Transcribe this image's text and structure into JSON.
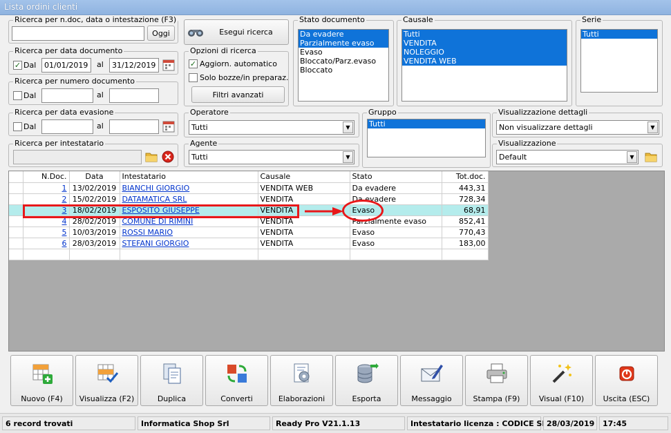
{
  "window": {
    "title": "Lista ordini clienti"
  },
  "search_doc": {
    "label": "Ricerca per n.doc, data o intestazione (F3)",
    "value": "",
    "button": "Oggi"
  },
  "execute_search": {
    "label": "Esegui ricerca"
  },
  "by_date": {
    "label": "Ricerca per data documento",
    "from_label": "Dal",
    "from_checked": true,
    "from_value": "01/01/2019",
    "to_label": "al",
    "to_value": "31/12/2019"
  },
  "search_options": {
    "label": "Opzioni di ricerca",
    "auto_update": "Aggiorn. automatico",
    "auto_update_checked": true,
    "drafts": "Solo bozze/in preparaz.",
    "drafts_checked": false,
    "advanced": "Filtri avanzati"
  },
  "by_number": {
    "label": "Ricerca per numero documento",
    "from_label": "Dal",
    "from_checked": false,
    "from_value": "",
    "to_label": "al",
    "to_value": ""
  },
  "doc_state": {
    "label": "Stato documento",
    "items": [
      {
        "text": "Da evadere",
        "selected": true
      },
      {
        "text": "Parzialmente evaso",
        "selected": true
      },
      {
        "text": "Evaso",
        "selected": false
      },
      {
        "text": "Bloccato/Parz.evaso",
        "selected": false
      },
      {
        "text": "Bloccato",
        "selected": false
      }
    ]
  },
  "causale": {
    "label": "Causale",
    "items": [
      {
        "text": "Tutti",
        "selected": true
      },
      {
        "text": "VENDITA",
        "selected": true
      },
      {
        "text": "NOLEGGIO",
        "selected": true
      },
      {
        "text": "VENDITA WEB",
        "selected": true
      }
    ]
  },
  "serie": {
    "label": "Serie",
    "items": [
      {
        "text": "Tutti",
        "selected": true
      }
    ]
  },
  "by_evasion": {
    "label": "Ricerca per data evasione",
    "from_label": "Dal",
    "from_checked": false,
    "from_value": "",
    "to_label": "al",
    "to_value": ""
  },
  "operator": {
    "label": "Operatore",
    "value": "Tutti"
  },
  "gruppo": {
    "label": "Gruppo",
    "items": [
      {
        "text": "Tutti",
        "selected": true
      }
    ]
  },
  "details_view": {
    "label": "Visualizzazione dettagli",
    "value": "Non visualizzare dettagli"
  },
  "by_holder": {
    "label": "Ricerca per intestatario",
    "value": ""
  },
  "agent": {
    "label": "Agente",
    "value": "Tutti"
  },
  "view": {
    "label": "Visualizzazione",
    "value": "Default"
  },
  "grid": {
    "columns": [
      "N.Doc.",
      "Data",
      "Intestatario",
      "Causale",
      "Stato",
      "Tot.doc."
    ],
    "rows": [
      {
        "num": "1",
        "date": "13/02/2019",
        "holder": "BIANCHI GIORGIO",
        "causale": "VENDITA WEB",
        "state": "Da evadere",
        "total": "443,31"
      },
      {
        "num": "2",
        "date": "15/02/2019",
        "holder": "DATAMATICA SRL",
        "causale": "VENDITA",
        "state": "Da evadere",
        "total": "728,34"
      },
      {
        "num": "3",
        "date": "18/02/2019",
        "holder": "ESPOSITO GIUSEPPE",
        "causale": "VENDITA",
        "state": "Evaso",
        "total": "68,91"
      },
      {
        "num": "4",
        "date": "28/02/2019",
        "holder": "COMUNE DI RIMINI",
        "causale": "VENDITA",
        "state": "Parzialmente evaso",
        "total": "852,41"
      },
      {
        "num": "5",
        "date": "10/03/2019",
        "holder": "ROSSI MARIO",
        "causale": "VENDITA",
        "state": "Evaso",
        "total": "770,43"
      },
      {
        "num": "6",
        "date": "28/03/2019",
        "holder": "STEFANI GIORGIO",
        "causale": "VENDITA",
        "state": "Evaso",
        "total": "183,00"
      }
    ],
    "highlight_color": "#b4ecec",
    "annotation_color": "#e8181a"
  },
  "toolbar": [
    {
      "label": "Nuovo (F4)",
      "icon": "new-grid-icon"
    },
    {
      "label": "Visualizza (F2)",
      "icon": "view-grid-icon"
    },
    {
      "label": "Duplica",
      "icon": "duplicate-icon"
    },
    {
      "label": "Converti",
      "icon": "convert-icon"
    },
    {
      "label": "Elaborazioni",
      "icon": "process-icon"
    },
    {
      "label": "Esporta",
      "icon": "export-icon"
    },
    {
      "label": "Messaggio",
      "icon": "message-icon"
    },
    {
      "label": "Stampa (F9)",
      "icon": "printer-icon"
    },
    {
      "label": "Visual (F10)",
      "icon": "magic-wand-icon"
    },
    {
      "label": "Uscita (ESC)",
      "icon": "exit-icon"
    }
  ],
  "status": {
    "records": "6 record trovati",
    "company": "Informatica Shop Srl",
    "version": "Ready Pro V21.1.13",
    "license": "Intestatario licenza : CODICE SRL",
    "date": "28/03/2019",
    "time": "17:45"
  }
}
